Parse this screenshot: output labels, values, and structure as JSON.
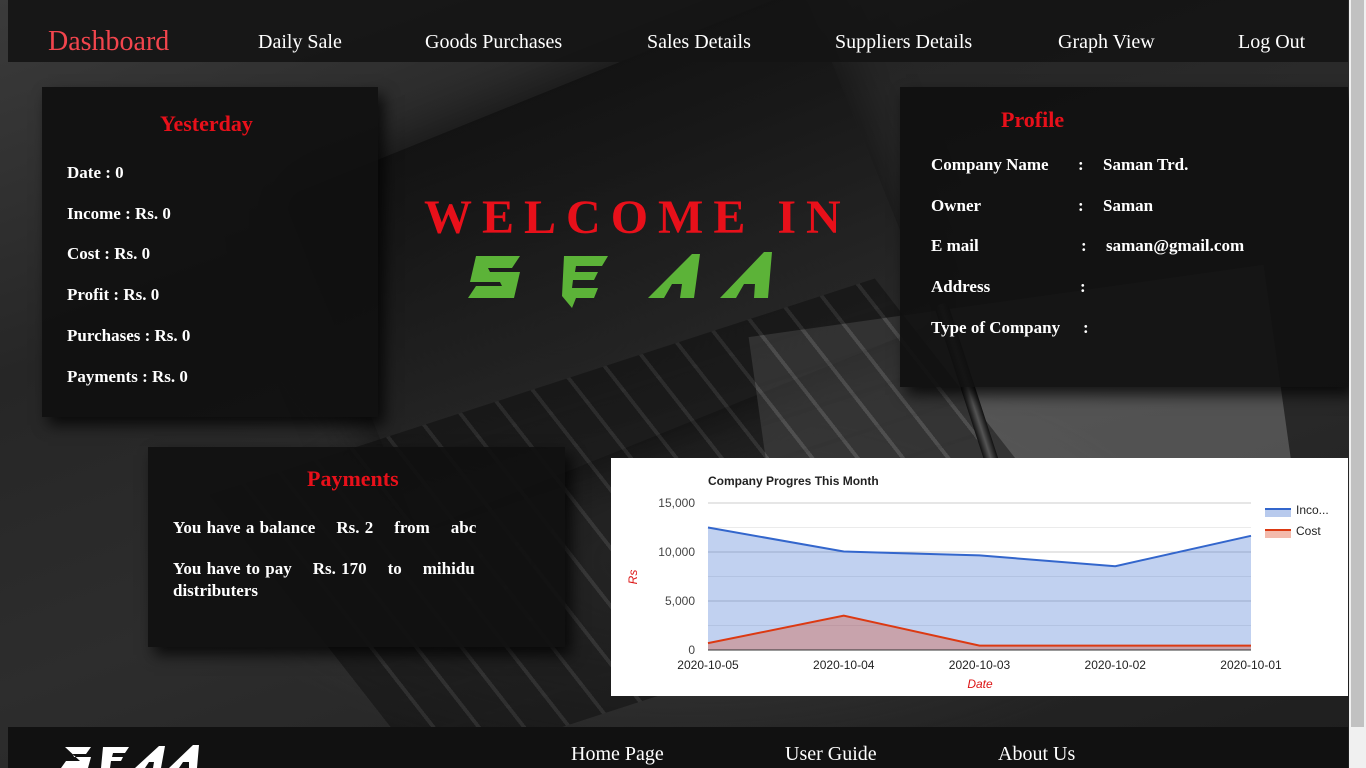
{
  "nav": {
    "brand": "Dashboard",
    "links": [
      "Daily Sale",
      "Goods Purchases",
      "Sales Details",
      "Suppliers Details",
      "Graph View",
      "Log Out"
    ]
  },
  "yesterday": {
    "title": "Yesterday",
    "rows": [
      "Date : 0",
      "Income : Rs. 0",
      "Cost : Rs. 0",
      "Profit : Rs. 0",
      "Purchases : Rs. 0",
      "Payments : Rs. 0"
    ]
  },
  "welcome": {
    "text": "WELCOME IN",
    "logo_text": "SEAA",
    "logo_color": "#5cb338"
  },
  "profile": {
    "title": "Profile",
    "fields": [
      {
        "label": "Company Name",
        "value": "Saman Trd."
      },
      {
        "label": "Owner",
        "value": "Saman"
      },
      {
        "label": "E mail",
        "value": "saman@gmail.com"
      },
      {
        "label": "Address",
        "value": ""
      },
      {
        "label": "Type of Company",
        "value": ""
      }
    ],
    "colon": ":"
  },
  "payments": {
    "title": "Payments",
    "line1": "You have a balance    Rs. 2    from    abc",
    "line2a": "You have to pay    Rs. 170    to    mihidu",
    "line2b": "distributers"
  },
  "chart_data": {
    "type": "area",
    "title": "Company Progres This Month",
    "xlabel": "Date",
    "ylabel": "Rs",
    "categories": [
      "2020-10-05",
      "2020-10-04",
      "2020-10-03",
      "2020-10-02",
      "2020-10-01"
    ],
    "series": [
      {
        "name": "Income",
        "legend_label": "Inco...",
        "color": "#3366cc",
        "values": [
          12500,
          10050,
          9650,
          8550,
          11650
        ]
      },
      {
        "name": "Cost",
        "legend_label": "Cost",
        "color": "#dc3912",
        "values": [
          700,
          3500,
          450,
          450,
          450
        ]
      }
    ],
    "ylim": [
      0,
      15000
    ],
    "yticks": [
      "15,000",
      "10,000",
      "5,000",
      "0"
    ],
    "ytick_values": [
      15000,
      10000,
      5000,
      0
    ],
    "grid": true,
    "legend_position": "right"
  },
  "footer": {
    "logo_text": "SEAA",
    "links": [
      "Home Page",
      "User Guide",
      "About Us"
    ]
  },
  "colors": {
    "accent_red": "#e8101a",
    "brand_red": "#f2454d",
    "logo_green": "#5cb338"
  }
}
